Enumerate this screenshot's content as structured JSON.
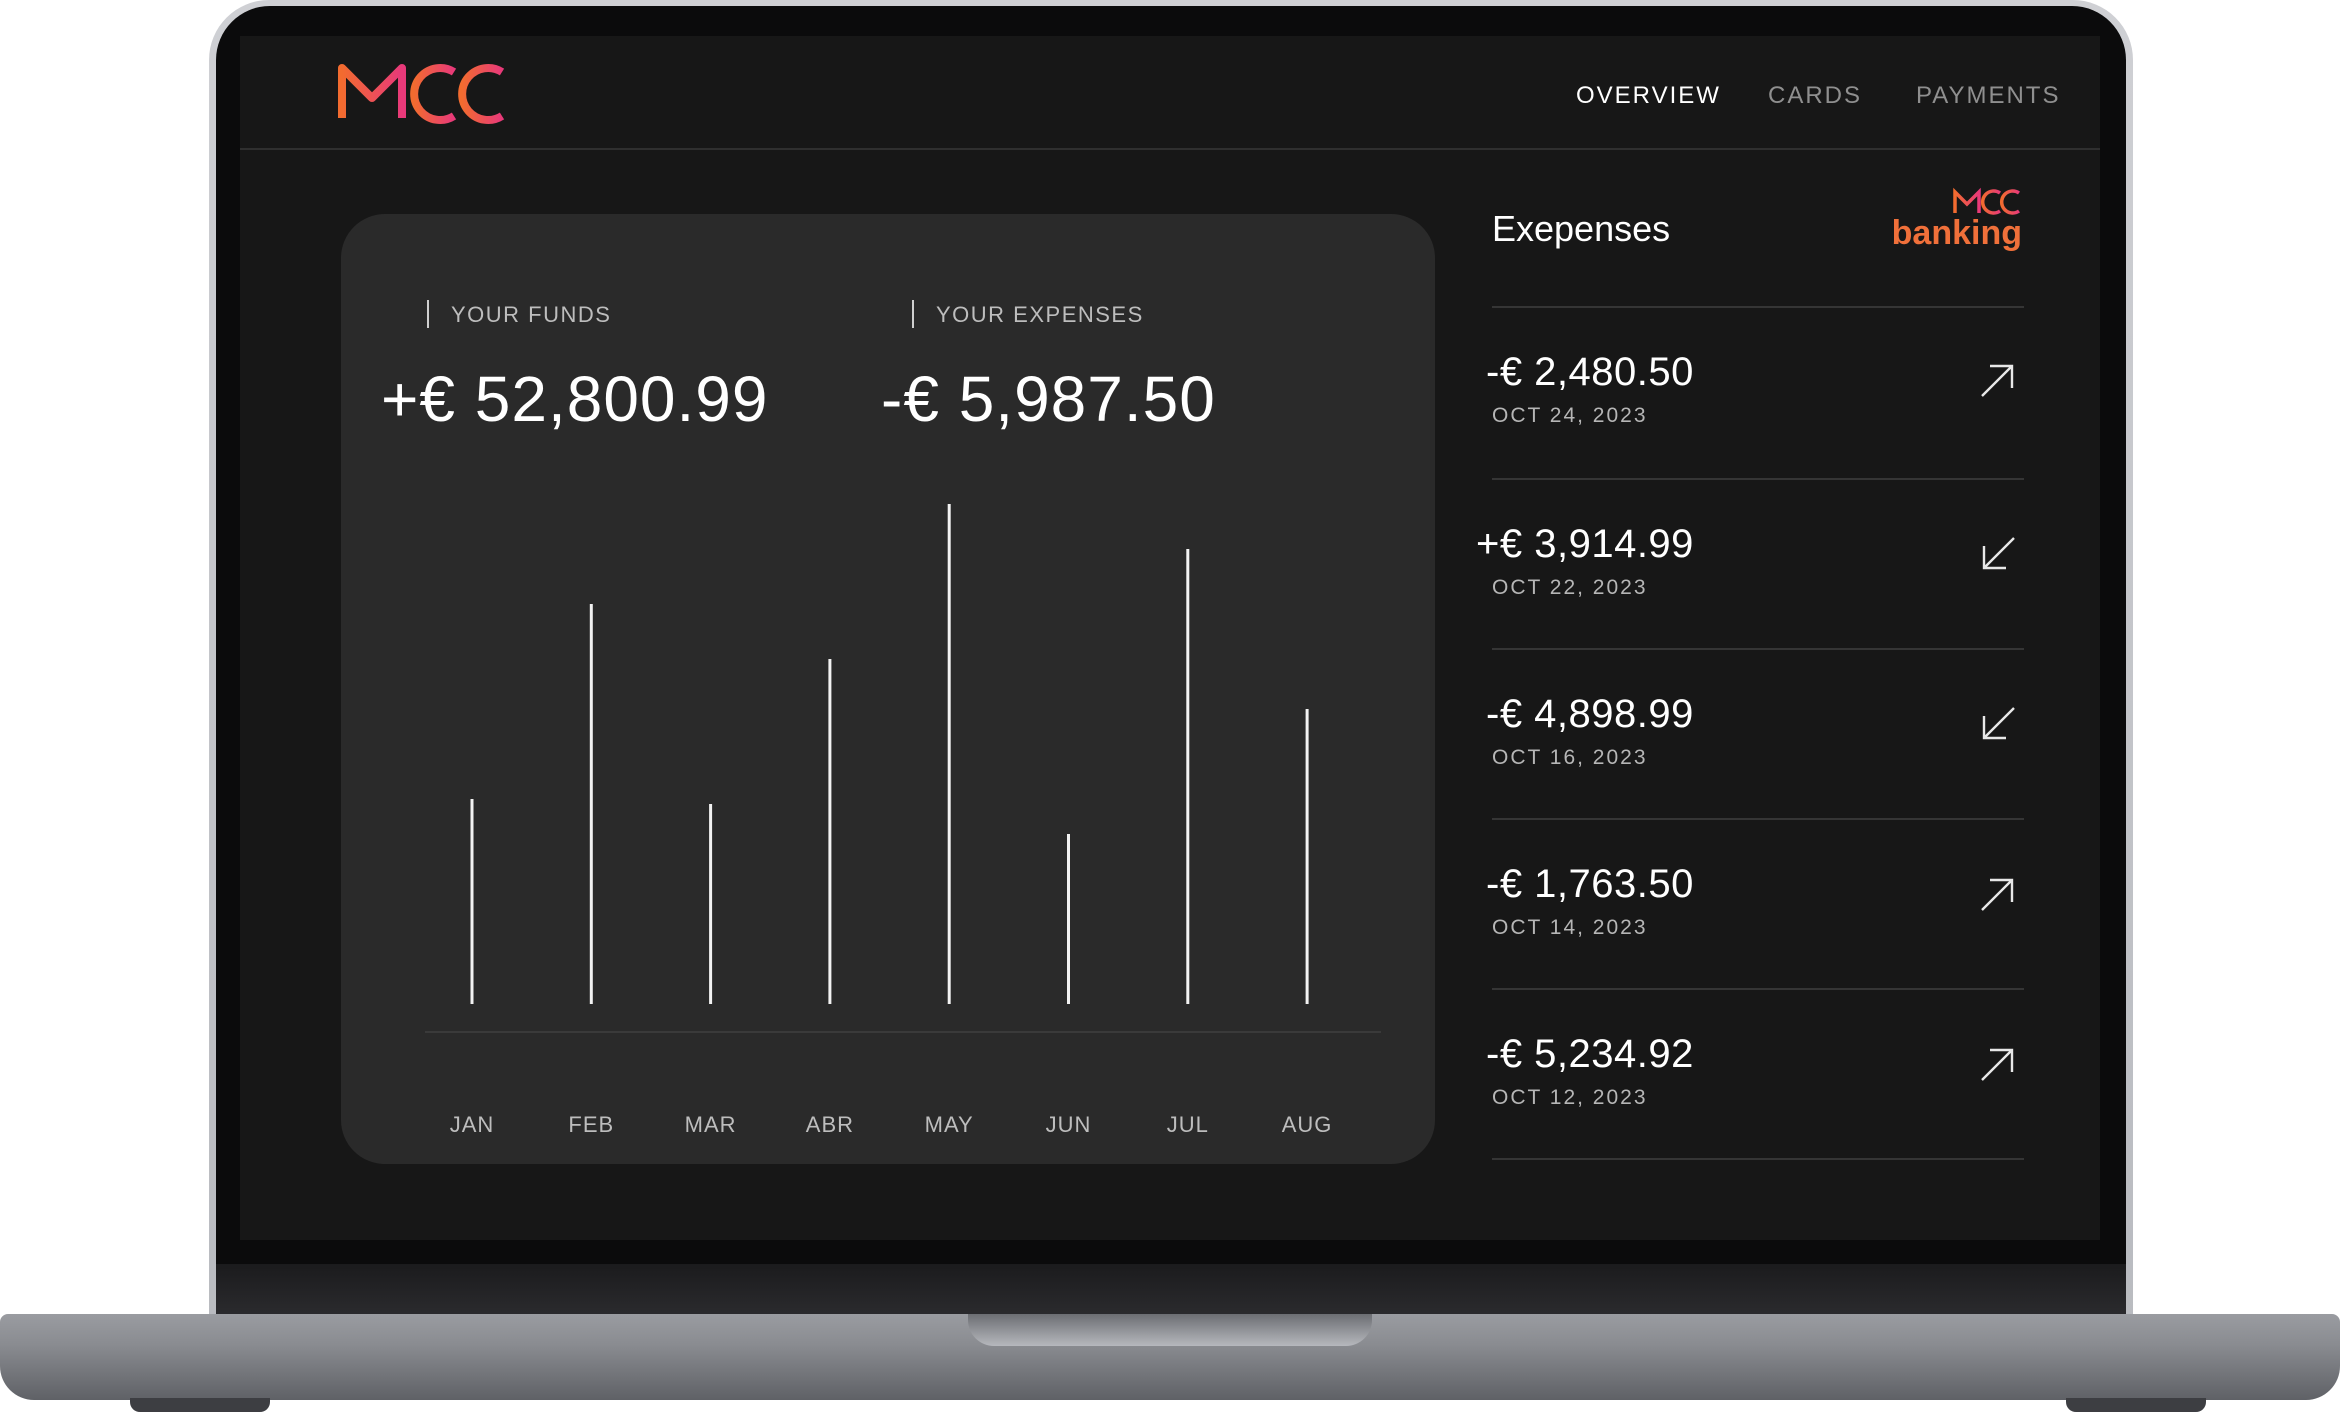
{
  "app": {
    "logo_text": "MCC",
    "brand_mcc": "MCC",
    "brand_word": "banking"
  },
  "nav": {
    "items": [
      {
        "label": "OVERVIEW",
        "active": true
      },
      {
        "label": "CARDS",
        "active": false
      },
      {
        "label": "PAYMENTS",
        "active": false
      }
    ]
  },
  "summary": {
    "funds_label": "YOUR FUNDS",
    "funds_value": "+€ 52,800.99",
    "expenses_label": "YOUR EXPENSES",
    "expenses_value": "-€ 5,987.50"
  },
  "chart_data": {
    "type": "bar",
    "categories": [
      "JAN",
      "FEB",
      "MAR",
      "ABR",
      "MAY",
      "JUN",
      "JUL",
      "AUG"
    ],
    "values": [
      41,
      80,
      40,
      69,
      100,
      34,
      91,
      59
    ],
    "ylim": [
      0,
      100
    ],
    "grid": false,
    "xlabel": "",
    "ylabel": ""
  },
  "expenses": {
    "title": "Exepenses",
    "transactions": [
      {
        "amount": "-€ 2,480.50",
        "date": "OCT 24, 2023",
        "icon": "arrow-up-right-icon"
      },
      {
        "amount": "+€ 3,914.99",
        "date": "OCT 22, 2023",
        "icon": "arrow-down-left-icon"
      },
      {
        "amount": "-€ 4,898.99",
        "date": "OCT 16, 2023",
        "icon": "arrow-down-left-icon"
      },
      {
        "amount": "-€ 1,763.50",
        "date": "OCT 14, 2023",
        "icon": "arrow-up-right-icon"
      },
      {
        "amount": "-€ 5,234.92",
        "date": "OCT 12, 2023",
        "icon": "arrow-up-right-icon"
      }
    ]
  },
  "colors": {
    "logo_start": "#f26b2f",
    "logo_end": "#e8397a",
    "screen_bg": "#171717",
    "card_bg": "#2a2a2a"
  }
}
